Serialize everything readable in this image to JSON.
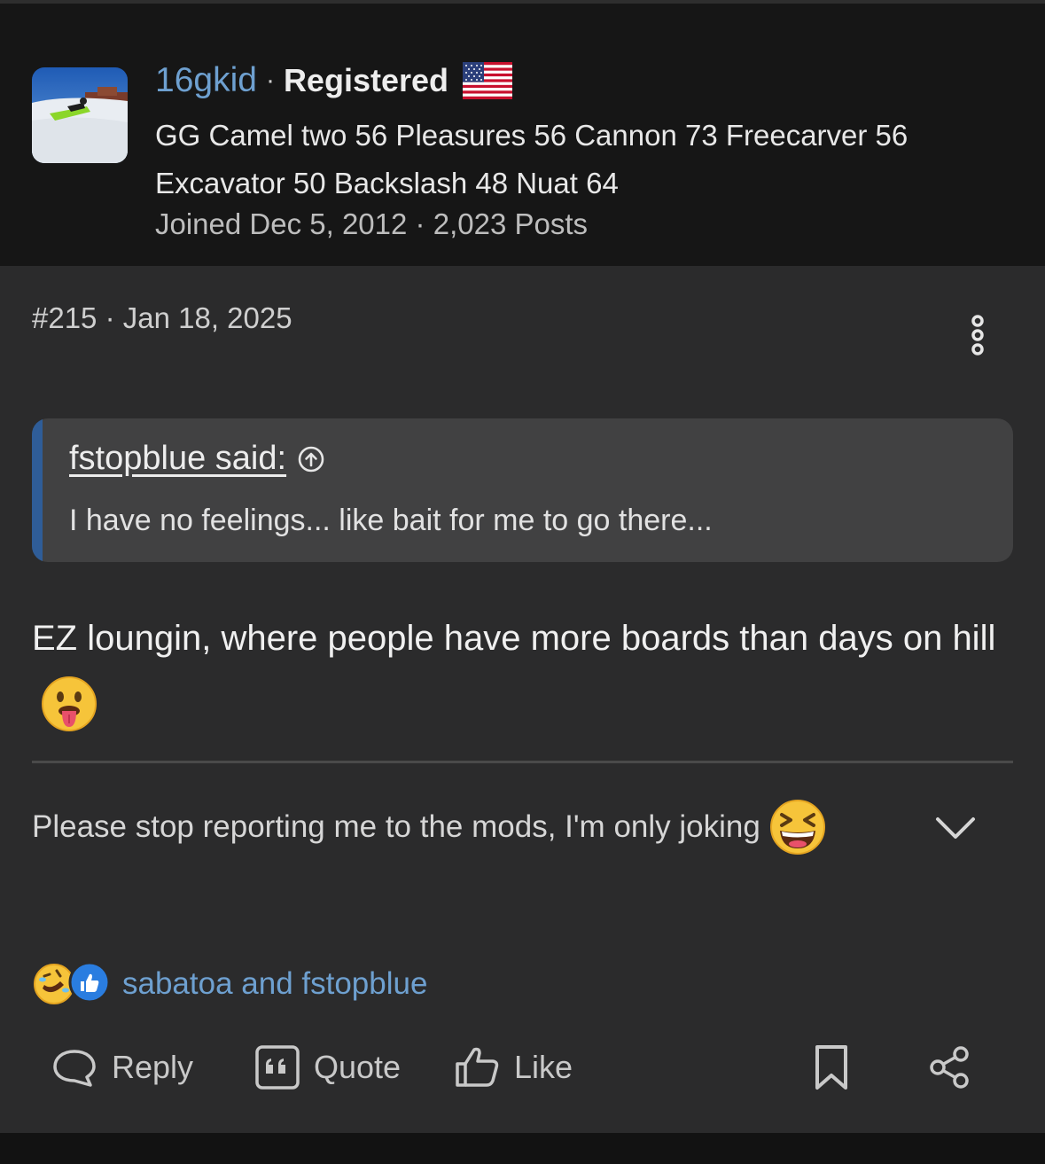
{
  "author": {
    "username": "16gkid",
    "role": "Registered",
    "flag_icon": "us-flag-icon",
    "signature": "GG Camel two 56 Pleasures 56 Cannon 73 Freecarver 56 Excavator 50 Backslash 48 Nuat 64",
    "joined": "Joined Dec 5, 2012",
    "posts": "2,023 Posts"
  },
  "post": {
    "number": "#215",
    "date": "Jan 18, 2025",
    "quote": {
      "author": "fstopblue said:",
      "text": "I have no feelings... like bait for me to go there..."
    },
    "body": "EZ loungin, where people have more boards than days on hill",
    "body_emoji": "tongue-out-emoji",
    "signature_line": "Please stop reporting me to the mods, I'm only joking",
    "signature_emoji": "laughing-emoji"
  },
  "reactions": {
    "icons": [
      "rofl-emoji",
      "thumbs-up-icon"
    ],
    "names": "sabatoa and fstopblue"
  },
  "actions": {
    "reply": "Reply",
    "quote": "Quote",
    "like": "Like"
  },
  "colors": {
    "link": "#6ea0d0",
    "quote_accent": "#2f5d98",
    "post_bg": "#2b2b2c",
    "header_bg": "#161616"
  }
}
